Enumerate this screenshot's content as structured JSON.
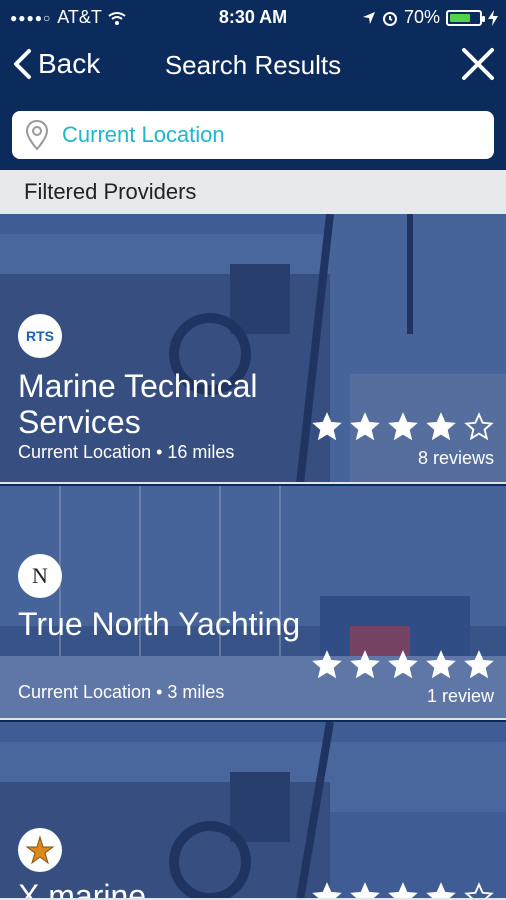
{
  "status": {
    "carrier": "AT&T",
    "time": "8:30 AM",
    "battery": "70%",
    "battery_level": 0.7
  },
  "nav": {
    "back": "Back",
    "title": "Search Results"
  },
  "search": {
    "placeholder": "Current Location"
  },
  "section": {
    "title": "Filtered Providers"
  },
  "providers": [
    {
      "name": "Marine Technical Services",
      "location": "Current Location",
      "distance": "16 miles",
      "meta": "Current Location • 16 miles",
      "rating": 4,
      "reviews": "8 reviews"
    },
    {
      "name": "True North Yachting",
      "location": "Current Location",
      "distance": "3 miles",
      "meta": "Current Location • 3 miles",
      "rating": 5,
      "reviews": "1 review"
    },
    {
      "name": "X marine",
      "rating": 4
    }
  ],
  "logos": {
    "marine_technical": "RTS",
    "true_north": "N"
  },
  "colors": {
    "navy": "#0c2b5d",
    "accent": "#1fb7c9",
    "section_bg": "#e7e8ea",
    "star": "#ffffff",
    "battery_green": "#52d44a"
  },
  "icons": [
    "back-chevron-icon",
    "close-icon",
    "location-pin-icon",
    "star-icon",
    "wifi-icon",
    "battery-icon",
    "alarm-icon",
    "location-arrow-icon",
    "charging-bolt-icon"
  ]
}
